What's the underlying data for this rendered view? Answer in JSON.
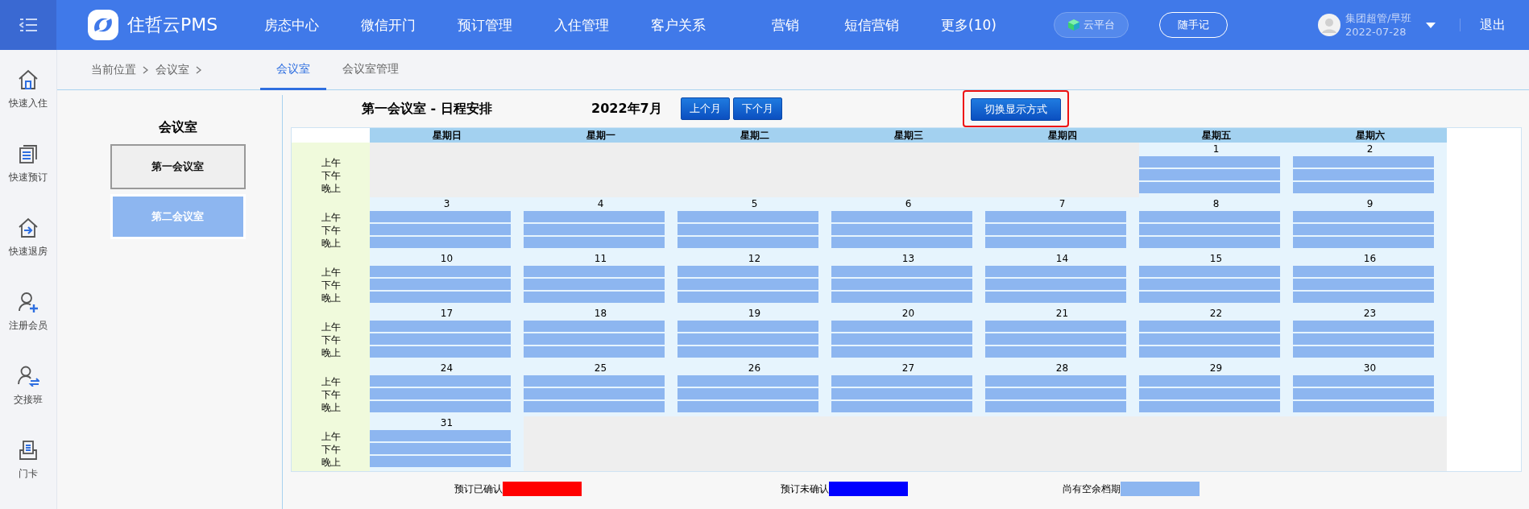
{
  "brand": "住哲云PMS",
  "nav": [
    "房态中心",
    "微信开门",
    "预订管理",
    "入住管理",
    "客户关系",
    "营销",
    "短信营销",
    "更多(10)"
  ],
  "cloud_button": "云平台",
  "note_button": "随手记",
  "user": {
    "name": "集团超管/早班",
    "date": "2022-07-28"
  },
  "logout": "退出",
  "sidebar": [
    {
      "label": "快速入住",
      "kind": "home"
    },
    {
      "label": "快速预订",
      "kind": "doc"
    },
    {
      "label": "快速退房",
      "kind": "checkout"
    },
    {
      "label": "注册会员",
      "kind": "useradd"
    },
    {
      "label": "交接班",
      "kind": "userswap"
    },
    {
      "label": "门卡",
      "kind": "card"
    }
  ],
  "breadcrumb": [
    "当前位置",
    "会议室"
  ],
  "tabs": [
    {
      "label": "会议室",
      "selected": true
    },
    {
      "label": "会议室管理",
      "selected": false
    }
  ],
  "rooms_title": "会议室",
  "rooms": [
    {
      "label": "第一会议室",
      "selected": true
    },
    {
      "label": "第二会议室",
      "selected": false
    }
  ],
  "schedule_title": "第一会议室 - 日程安排",
  "month": "2022年7月",
  "prev_button": "上个月",
  "next_button": "下个月",
  "switch_button": "切换显示方式",
  "weekdays": [
    "星期日",
    "星期一",
    "星期二",
    "星期三",
    "星期四",
    "星期五",
    "星期六"
  ],
  "weeks": [
    {
      "periods": [
        "上午",
        "下午",
        "晚上"
      ],
      "days": [
        {
          "kind": "blank"
        },
        {
          "kind": "blank"
        },
        {
          "kind": "blank"
        },
        {
          "kind": "blank"
        },
        {
          "kind": "blank"
        },
        {
          "kind": "day",
          "day": "1",
          "slots": [
            {
              "color": "#8db6f0"
            },
            {
              "color": "#8db6f0"
            },
            {
              "color": "#8db6f0"
            }
          ]
        },
        {
          "kind": "day",
          "day": "2",
          "slots": [
            {
              "color": "#8db6f0"
            },
            {
              "color": "#8db6f0"
            },
            {
              "color": "#8db6f0"
            }
          ]
        }
      ]
    },
    {
      "periods": [
        "上午",
        "下午",
        "晚上"
      ],
      "days": [
        {
          "kind": "day",
          "day": "3",
          "slots": [
            {
              "color": "#8db6f0"
            },
            {
              "color": "#8db6f0"
            },
            {
              "color": "#8db6f0"
            }
          ]
        },
        {
          "kind": "day",
          "day": "4",
          "slots": [
            {
              "color": "#8db6f0"
            },
            {
              "color": "#8db6f0"
            },
            {
              "color": "#8db6f0"
            }
          ]
        },
        {
          "kind": "day",
          "day": "5",
          "slots": [
            {
              "color": "#8db6f0"
            },
            {
              "color": "#8db6f0"
            },
            {
              "color": "#8db6f0"
            }
          ]
        },
        {
          "kind": "day",
          "day": "6",
          "slots": [
            {
              "color": "#8db6f0"
            },
            {
              "color": "#8db6f0"
            },
            {
              "color": "#8db6f0"
            }
          ]
        },
        {
          "kind": "day",
          "day": "7",
          "slots": [
            {
              "color": "#8db6f0"
            },
            {
              "color": "#8db6f0"
            },
            {
              "color": "#8db6f0"
            }
          ]
        },
        {
          "kind": "day",
          "day": "8",
          "slots": [
            {
              "color": "#8db6f0"
            },
            {
              "color": "#8db6f0"
            },
            {
              "color": "#8db6f0"
            }
          ]
        },
        {
          "kind": "day",
          "day": "9",
          "slots": [
            {
              "color": "#8db6f0"
            },
            {
              "color": "#8db6f0"
            },
            {
              "color": "#8db6f0"
            }
          ]
        }
      ]
    },
    {
      "periods": [
        "上午",
        "下午",
        "晚上"
      ],
      "days": [
        {
          "kind": "day",
          "day": "10",
          "slots": [
            {
              "color": "#8db6f0"
            },
            {
              "color": "#8db6f0"
            },
            {
              "color": "#8db6f0"
            }
          ]
        },
        {
          "kind": "day",
          "day": "11",
          "slots": [
            {
              "color": "#8db6f0"
            },
            {
              "color": "#8db6f0"
            },
            {
              "color": "#8db6f0"
            }
          ]
        },
        {
          "kind": "day",
          "day": "12",
          "slots": [
            {
              "color": "#8db6f0"
            },
            {
              "color": "#8db6f0"
            },
            {
              "color": "#8db6f0"
            }
          ]
        },
        {
          "kind": "day",
          "day": "13",
          "slots": [
            {
              "color": "#8db6f0"
            },
            {
              "color": "#8db6f0"
            },
            {
              "color": "#8db6f0"
            }
          ]
        },
        {
          "kind": "day",
          "day": "14",
          "slots": [
            {
              "color": "#8db6f0"
            },
            {
              "color": "#8db6f0"
            },
            {
              "color": "#8db6f0"
            }
          ]
        },
        {
          "kind": "day",
          "day": "15",
          "slots": [
            {
              "color": "#8db6f0"
            },
            {
              "color": "#8db6f0"
            },
            {
              "color": "#8db6f0"
            }
          ]
        },
        {
          "kind": "day",
          "day": "16",
          "slots": [
            {
              "color": "#8db6f0"
            },
            {
              "color": "#8db6f0"
            },
            {
              "color": "#8db6f0"
            }
          ]
        }
      ]
    },
    {
      "periods": [
        "上午",
        "下午",
        "晚上"
      ],
      "days": [
        {
          "kind": "day",
          "day": "17",
          "slots": [
            {
              "color": "#8db6f0"
            },
            {
              "color": "#8db6f0"
            },
            {
              "color": "#8db6f0"
            }
          ]
        },
        {
          "kind": "day",
          "day": "18",
          "slots": [
            {
              "color": "#8db6f0"
            },
            {
              "color": "#8db6f0"
            },
            {
              "color": "#8db6f0"
            }
          ]
        },
        {
          "kind": "day",
          "day": "19",
          "slots": [
            {
              "color": "#8db6f0"
            },
            {
              "color": "#8db6f0"
            },
            {
              "color": "#8db6f0"
            }
          ]
        },
        {
          "kind": "day",
          "day": "20",
          "slots": [
            {
              "color": "#8db6f0"
            },
            {
              "color": "#8db6f0"
            },
            {
              "color": "#8db6f0"
            }
          ]
        },
        {
          "kind": "day",
          "day": "21",
          "slots": [
            {
              "color": "#8db6f0"
            },
            {
              "color": "#8db6f0"
            },
            {
              "color": "#8db6f0"
            }
          ]
        },
        {
          "kind": "day",
          "day": "22",
          "slots": [
            {
              "color": "#8db6f0"
            },
            {
              "color": "#8db6f0"
            },
            {
              "color": "#8db6f0"
            }
          ]
        },
        {
          "kind": "day",
          "day": "23",
          "slots": [
            {
              "color": "#8db6f0"
            },
            {
              "color": "#8db6f0"
            },
            {
              "color": "#8db6f0"
            }
          ]
        }
      ]
    },
    {
      "periods": [
        "上午",
        "下午",
        "晚上"
      ],
      "days": [
        {
          "kind": "day",
          "day": "24",
          "slots": [
            {
              "color": "#8db6f0"
            },
            {
              "color": "#8db6f0"
            },
            {
              "color": "#8db6f0"
            }
          ]
        },
        {
          "kind": "day",
          "day": "25",
          "slots": [
            {
              "color": "#8db6f0"
            },
            {
              "color": "#8db6f0"
            },
            {
              "color": "#8db6f0"
            }
          ]
        },
        {
          "kind": "day",
          "day": "26",
          "slots": [
            {
              "color": "#8db6f0"
            },
            {
              "color": "#8db6f0"
            },
            {
              "color": "#8db6f0"
            }
          ]
        },
        {
          "kind": "day",
          "day": "27",
          "slots": [
            {
              "color": "#8db6f0"
            },
            {
              "color": "#8db6f0"
            },
            {
              "color": "#8db6f0"
            }
          ]
        },
        {
          "kind": "day",
          "day": "28",
          "slots": [
            {
              "color": "#8db6f0"
            },
            {
              "color": "#8db6f0"
            },
            {
              "color": "#8db6f0"
            }
          ]
        },
        {
          "kind": "day",
          "day": "29",
          "slots": [
            {
              "color": "#8db6f0"
            },
            {
              "color": "#8db6f0"
            },
            {
              "color": "#8db6f0"
            }
          ]
        },
        {
          "kind": "day",
          "day": "30",
          "slots": [
            {
              "color": "#8db6f0"
            },
            {
              "color": "#8db6f0"
            },
            {
              "color": "#8db6f0"
            }
          ]
        }
      ]
    },
    {
      "periods": [
        "上午",
        "下午",
        "晚上"
      ],
      "days": [
        {
          "kind": "day",
          "day": "31",
          "slots": [
            {
              "color": "#8db6f0"
            },
            {
              "color": "#8db6f0"
            },
            {
              "color": "#8db6f0"
            }
          ]
        },
        {
          "kind": "blank"
        },
        {
          "kind": "blank"
        },
        {
          "kind": "blank"
        },
        {
          "kind": "blank"
        },
        {
          "kind": "blank"
        },
        {
          "kind": "blank"
        }
      ]
    }
  ],
  "legend": [
    {
      "label": "预订已确认",
      "color": "#ff0000"
    },
    {
      "label": "预订未确认",
      "color": "#0000ff"
    },
    {
      "label": "尚有空余档期",
      "color": "#8db6f0"
    }
  ]
}
